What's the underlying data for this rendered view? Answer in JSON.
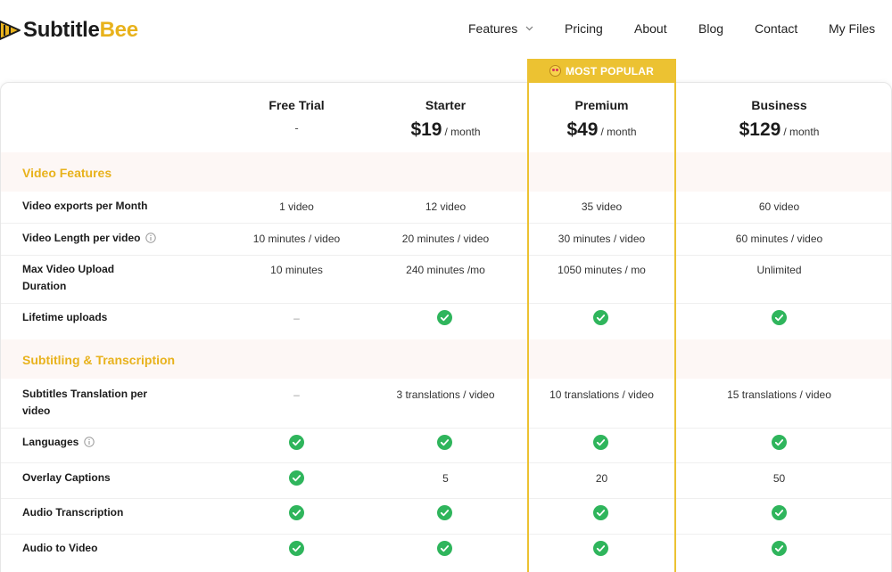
{
  "brand": {
    "name_main": "Subtitle",
    "name_accent": "Bee",
    "accent_color": "#e8b21c"
  },
  "nav": {
    "features": "Features",
    "pricing": "Pricing",
    "about": "About",
    "blog": "Blog",
    "contact": "Contact",
    "my_files": "My Files"
  },
  "popular_badge": "MOST POPULAR",
  "plans": [
    {
      "name": "Free Trial",
      "price": "",
      "period": "",
      "note": "-"
    },
    {
      "name": "Starter",
      "price": "$19",
      "period": "/ month"
    },
    {
      "name": "Premium",
      "price": "$49",
      "period": "/ month"
    },
    {
      "name": "Business",
      "price": "$129",
      "period": "/ month"
    }
  ],
  "sections": [
    {
      "title": "Video Features",
      "rows": [
        {
          "label": "Video exports per Month",
          "info": false,
          "values": [
            "1 video",
            "12 video",
            "35 video",
            "60 video"
          ]
        },
        {
          "label": "Video Length per video",
          "info": true,
          "values": [
            "10 minutes / video",
            "20 minutes / video",
            "30 minutes / video",
            "60 minutes / video"
          ]
        },
        {
          "label": "Max Video Upload Duration",
          "info": false,
          "values": [
            "10 minutes",
            "240 minutes /mo",
            "1050 minutes / mo",
            "Unlimited"
          ]
        },
        {
          "label": "Lifetime uploads",
          "info": false,
          "values": [
            "–",
            "check",
            "check",
            "check"
          ]
        }
      ]
    },
    {
      "title": "Subtitling & Transcription",
      "rows": [
        {
          "label": "Subtitles Translation per video",
          "info": false,
          "values": [
            "–",
            "3 translations / video",
            "10 translations / video",
            "15 translations / video"
          ]
        },
        {
          "label": "Languages",
          "info": true,
          "values": [
            "check",
            "check",
            "check",
            "check"
          ]
        },
        {
          "label": "Overlay Captions",
          "info": false,
          "values": [
            "check",
            "5",
            "20",
            "50"
          ]
        },
        {
          "label": "Audio Transcription",
          "info": false,
          "values": [
            "check",
            "check",
            "check",
            "check"
          ]
        },
        {
          "label": "Audio to Video",
          "info": false,
          "values": [
            "check",
            "check",
            "check",
            "check"
          ]
        }
      ]
    }
  ],
  "icons": {
    "check": "check-circle-icon",
    "info": "info-icon",
    "chevron": "chevron-down-icon"
  },
  "colors": {
    "check_green": "#2fb55c",
    "highlight": "#ecc232",
    "section_bg": "#fdf7f5"
  }
}
